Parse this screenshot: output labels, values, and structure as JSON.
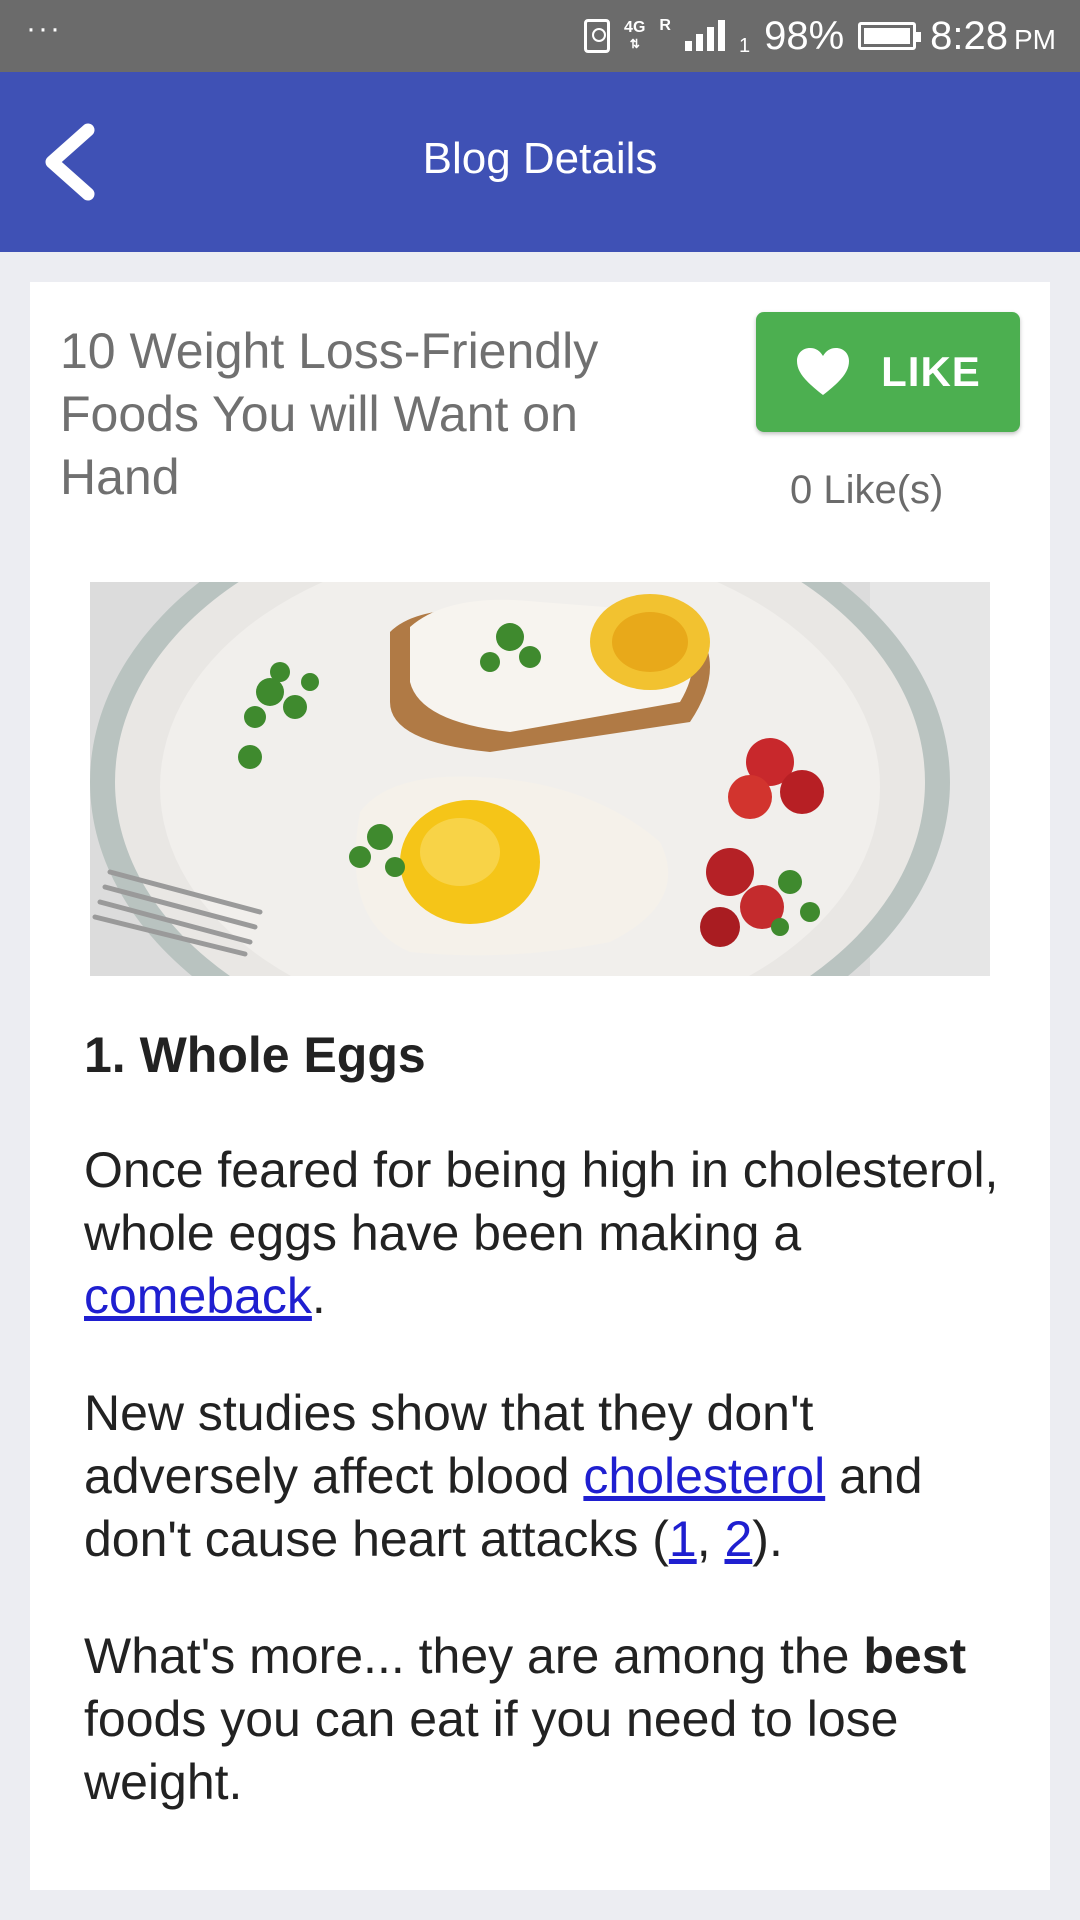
{
  "status_bar": {
    "dots": "···",
    "network_type": "4G",
    "roaming": "R",
    "sim_slot": "1",
    "battery_percent": "98%",
    "time": "8:28",
    "ampm": "PM"
  },
  "app_bar": {
    "title": "Blog Details",
    "back_icon": "chevron-left-icon"
  },
  "post": {
    "title": "10 Weight Loss-Friendly Foods You will Want on Hand",
    "like_button_label": "LIKE",
    "like_icon": "heart-icon",
    "like_count_text": "0 Like(s)"
  },
  "article": {
    "heading": "1. Whole Eggs",
    "p1_text": "Once feared for being high in cholesterol, whole eggs have been making a ",
    "p1_link": "comeback",
    "p1_end": ".",
    "p2_text": "New studies show that they don't adversely affect blood ",
    "p2_link": "cholesterol",
    "p2_mid": " and don't cause heart attacks (",
    "p2_ref1": "1",
    "p2_sep": ", ",
    "p2_ref2": "2",
    "p2_end": ").",
    "p3_text": "What's more... they are among the ",
    "p3_bold": "best",
    "p3_end": " foods you can eat if you need to lose weight."
  },
  "colors": {
    "app_bar": "#3f51b5",
    "status_bar": "#6b6b6b",
    "like_button": "#4caf50",
    "link": "#1f1fd0",
    "background": "#ecedf2"
  }
}
